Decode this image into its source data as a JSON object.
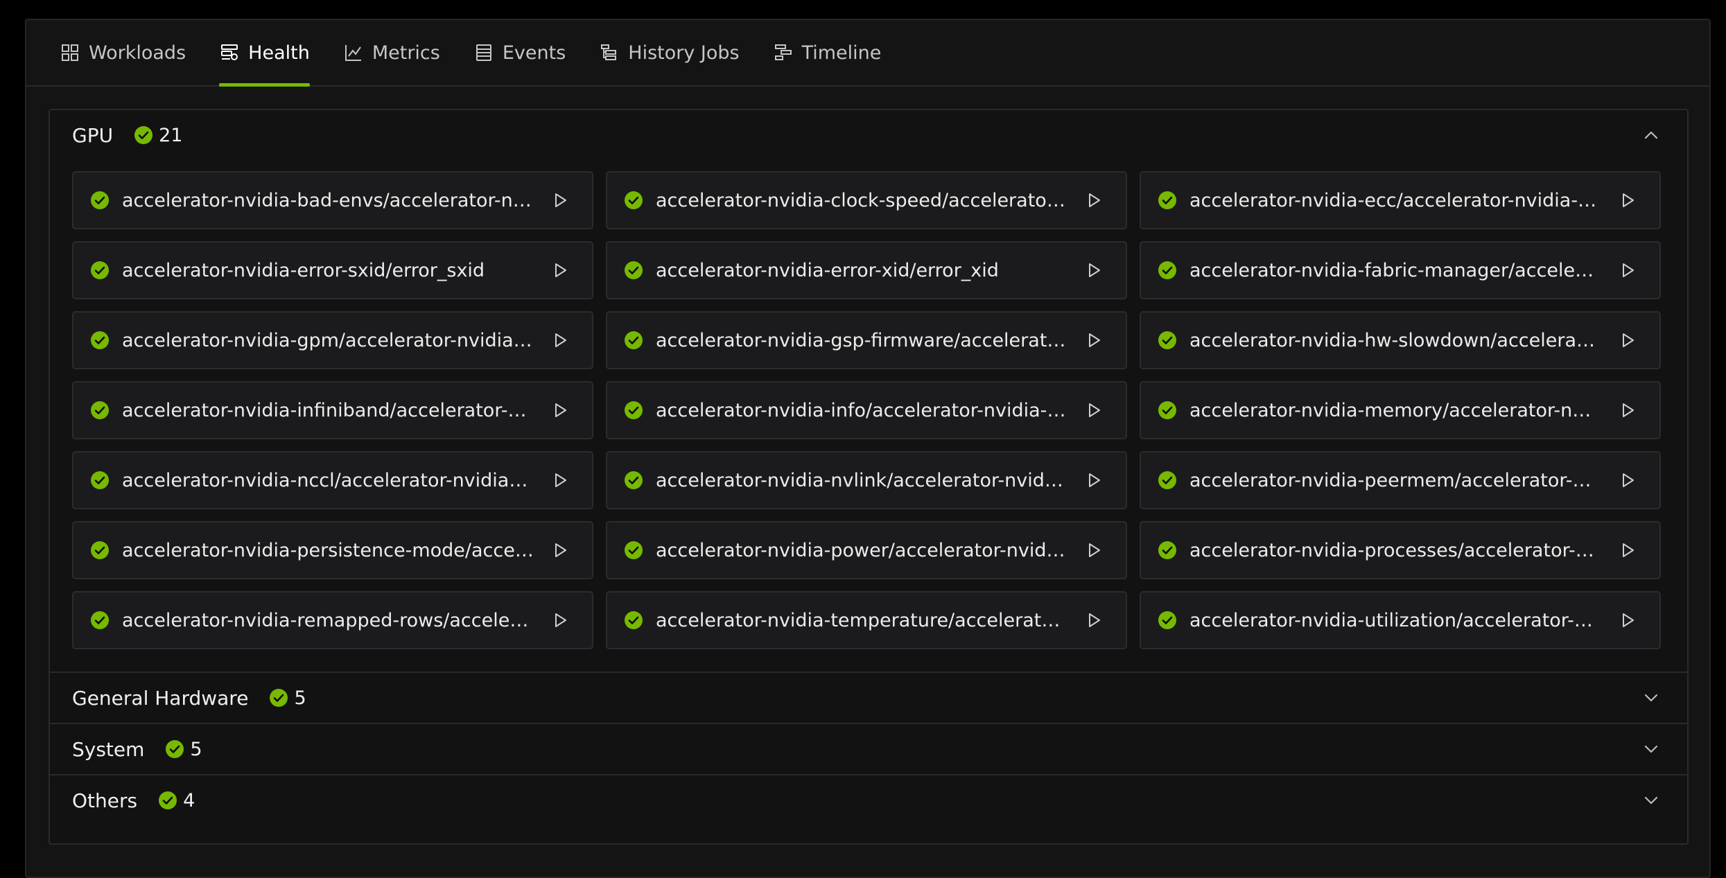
{
  "tabs": [
    {
      "label": "Workloads",
      "icon": "grid-icon",
      "active": false
    },
    {
      "label": "Health",
      "icon": "health-icon",
      "active": true
    },
    {
      "label": "Metrics",
      "icon": "chart-icon",
      "active": false
    },
    {
      "label": "Events",
      "icon": "list-icon",
      "active": false
    },
    {
      "label": "History Jobs",
      "icon": "history-icon",
      "active": false
    },
    {
      "label": "Timeline",
      "icon": "timeline-icon",
      "active": false
    }
  ],
  "colors": {
    "accent": "#76b900",
    "check": "#76b900"
  },
  "gpu": {
    "title": "GPU",
    "count": "21",
    "items": [
      "accelerator-nvidia-bad-envs/accelerator-nvidia-bad-envs",
      "accelerator-nvidia-clock-speed/accelerator-nvidia-clock-speed",
      "accelerator-nvidia-ecc/accelerator-nvidia-ecc",
      "accelerator-nvidia-error-sxid/error_sxid",
      "accelerator-nvidia-error-xid/error_xid",
      "accelerator-nvidia-fabric-manager/accelerator-nvidia-fabric-manager",
      "accelerator-nvidia-gpm/accelerator-nvidia-gpm",
      "accelerator-nvidia-gsp-firmware/accelerator-nvidia-gsp-firmware",
      "accelerator-nvidia-hw-slowdown/accelerator-nvidia-hw-slowdown",
      "accelerator-nvidia-infiniband/accelerator-nvidia-infiniband",
      "accelerator-nvidia-info/accelerator-nvidia-info",
      "accelerator-nvidia-memory/accelerator-nvidia-memory",
      "accelerator-nvidia-nccl/accelerator-nvidia-nccl",
      "accelerator-nvidia-nvlink/accelerator-nvidia-nvlink",
      "accelerator-nvidia-peermem/accelerator-nvidia-peermem",
      "accelerator-nvidia-persistence-mode/accelerator-nvidia-persistence-mode",
      "accelerator-nvidia-power/accelerator-nvidia-power",
      "accelerator-nvidia-processes/accelerator-nvidia-processes",
      "accelerator-nvidia-remapped-rows/accelerator-nvidia-remapped-rows",
      "accelerator-nvidia-temperature/accelerator-nvidia-temperature",
      "accelerator-nvidia-utilization/accelerator-nvidia-utilization"
    ]
  },
  "sections": [
    {
      "title": "General Hardware",
      "count": "5"
    },
    {
      "title": "System",
      "count": "5"
    },
    {
      "title": "Others",
      "count": "4"
    }
  ]
}
